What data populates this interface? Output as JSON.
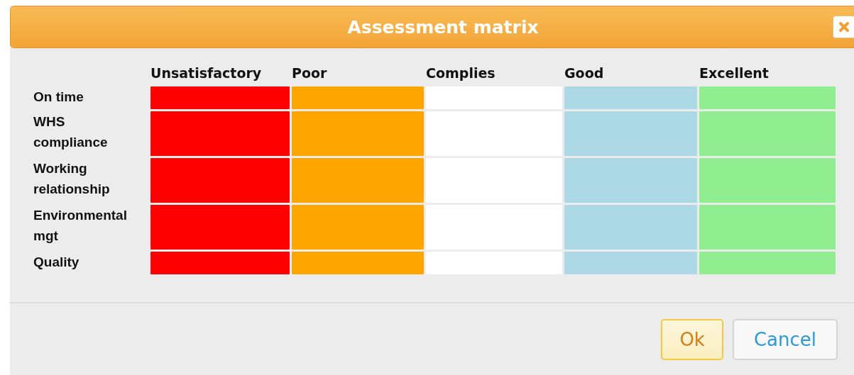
{
  "window": {
    "title": "Assessment matrix"
  },
  "columns": [
    {
      "label": "Unsatisfactory",
      "color": "#ff0000"
    },
    {
      "label": "Poor",
      "color": "#ffa500"
    },
    {
      "label": "Complies",
      "color": "#ffffff"
    },
    {
      "label": "Good",
      "color": "#add8e6"
    },
    {
      "label": "Excellent",
      "color": "#90ee90"
    }
  ],
  "rows": [
    "On time",
    "WHS compliance",
    "Working relationship",
    "Environmental mgt",
    "Quality"
  ],
  "buttons": [
    {
      "label": "Ok",
      "kind": "primary"
    },
    {
      "label": "Cancel",
      "kind": "secondary"
    }
  ]
}
